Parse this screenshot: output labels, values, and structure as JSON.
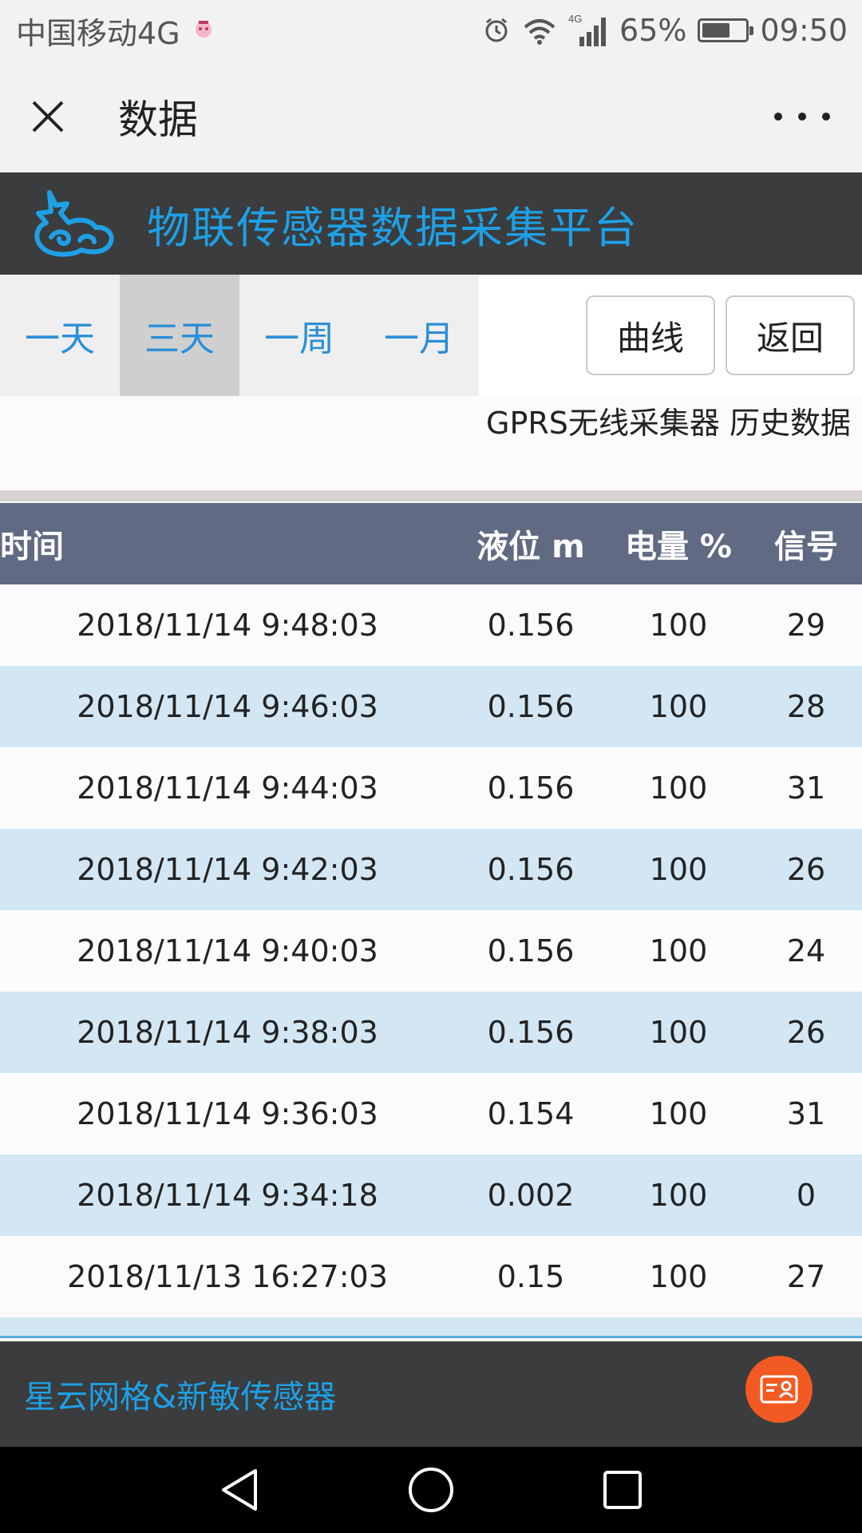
{
  "status_bar": {
    "carrier": "中国移动4G",
    "network_badge": "4G",
    "battery_percent": "65%",
    "battery_level": 0.65,
    "time": "09:50"
  },
  "title_bar": {
    "title": "数据"
  },
  "app_header": {
    "title": "物联传感器数据采集平台"
  },
  "toolbar": {
    "tabs": [
      "一天",
      "三天",
      "一周",
      "一月"
    ],
    "active_tab": "三天",
    "curve_label": "曲线",
    "back_label": "返回"
  },
  "subtitle": "GPRS无线采集器 历史数据",
  "table": {
    "headers": [
      "时间",
      "液位 m",
      "电量 %",
      "信号"
    ],
    "rows": [
      [
        "2018/11/14 9:48:03",
        "0.156",
        "100",
        "29"
      ],
      [
        "2018/11/14 9:46:03",
        "0.156",
        "100",
        "28"
      ],
      [
        "2018/11/14 9:44:03",
        "0.156",
        "100",
        "31"
      ],
      [
        "2018/11/14 9:42:03",
        "0.156",
        "100",
        "26"
      ],
      [
        "2018/11/14 9:40:03",
        "0.156",
        "100",
        "24"
      ],
      [
        "2018/11/14 9:38:03",
        "0.156",
        "100",
        "26"
      ],
      [
        "2018/11/14 9:36:03",
        "0.154",
        "100",
        "31"
      ],
      [
        "2018/11/14 9:34:18",
        "0.002",
        "100",
        "0"
      ],
      [
        "2018/11/13 16:27:03",
        "0.15",
        "100",
        "27"
      ]
    ]
  },
  "footer": {
    "text": "星云网格&新敏传感器"
  },
  "colors": {
    "accent": "#1ea0e6",
    "header_bg": "#3a3c3d",
    "table_head_bg": "#606a82",
    "row_alt_bg": "#d2e7f3",
    "fab_bg": "#f35a23"
  }
}
